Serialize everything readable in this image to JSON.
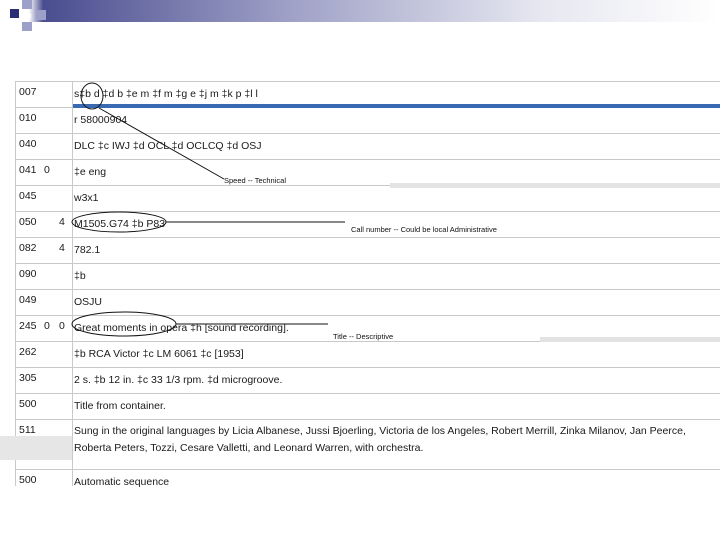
{
  "record": {
    "rows": [
      {
        "tag": "007",
        "ind1": "",
        "ind2": "",
        "value": "s‡b d ‡d b ‡e m ‡f m ‡g e ‡j m ‡k p ‡l l"
      },
      {
        "tag": "010",
        "ind1": "",
        "ind2": "",
        "value": "r 58000904"
      },
      {
        "tag": "040",
        "ind1": "",
        "ind2": "",
        "value": "DLC ‡c IWJ ‡d OCL ‡d OCLCQ ‡d OSJ"
      },
      {
        "tag": "041",
        "ind1": "0",
        "ind2": "",
        "value": "‡e eng"
      },
      {
        "tag": "045",
        "ind1": "",
        "ind2": "",
        "value": "w3x1"
      },
      {
        "tag": "050",
        "ind1": "",
        "ind2": "4",
        "value": "M1505.G74 ‡b P83"
      },
      {
        "tag": "082",
        "ind1": "",
        "ind2": "4",
        "value": "782.1"
      },
      {
        "tag": "090",
        "ind1": "",
        "ind2": "",
        "value": "‡b"
      },
      {
        "tag": "049",
        "ind1": "",
        "ind2": "",
        "value": "OSJU"
      },
      {
        "tag": "245",
        "ind1": "0",
        "ind2": "0",
        "value": "Great moments in opera ‡h [sound recording]."
      },
      {
        "tag": "262",
        "ind1": "",
        "ind2": "",
        "value": "‡b RCA Victor ‡c LM 6061 ‡c [1953]"
      },
      {
        "tag": "305",
        "ind1": "",
        "ind2": "",
        "value": "2 s. ‡b 12 in. ‡c 33 1/3 rpm. ‡d microgroove."
      },
      {
        "tag": "500",
        "ind1": "",
        "ind2": "",
        "value": "Title from container."
      },
      {
        "tag": "511",
        "ind1": "",
        "ind2": "",
        "value": "Sung in the original languages by Licia Albanese, Jussi Bjoerling, Victoria de los Angeles, Robert Merrill, Zinka Milanov, Jan Peerce, Roberta Peters, Tozzi, Cesare Valletti, and Leonard Warren, with orchestra."
      },
      {
        "tag": "500",
        "ind1": "",
        "ind2": "",
        "value": "Automatic sequence"
      }
    ]
  },
  "annotations": {
    "speed": "Speed -- Technical",
    "call_number": "Call number -- Could be local Administrative",
    "title": "Title -- Descriptive"
  }
}
